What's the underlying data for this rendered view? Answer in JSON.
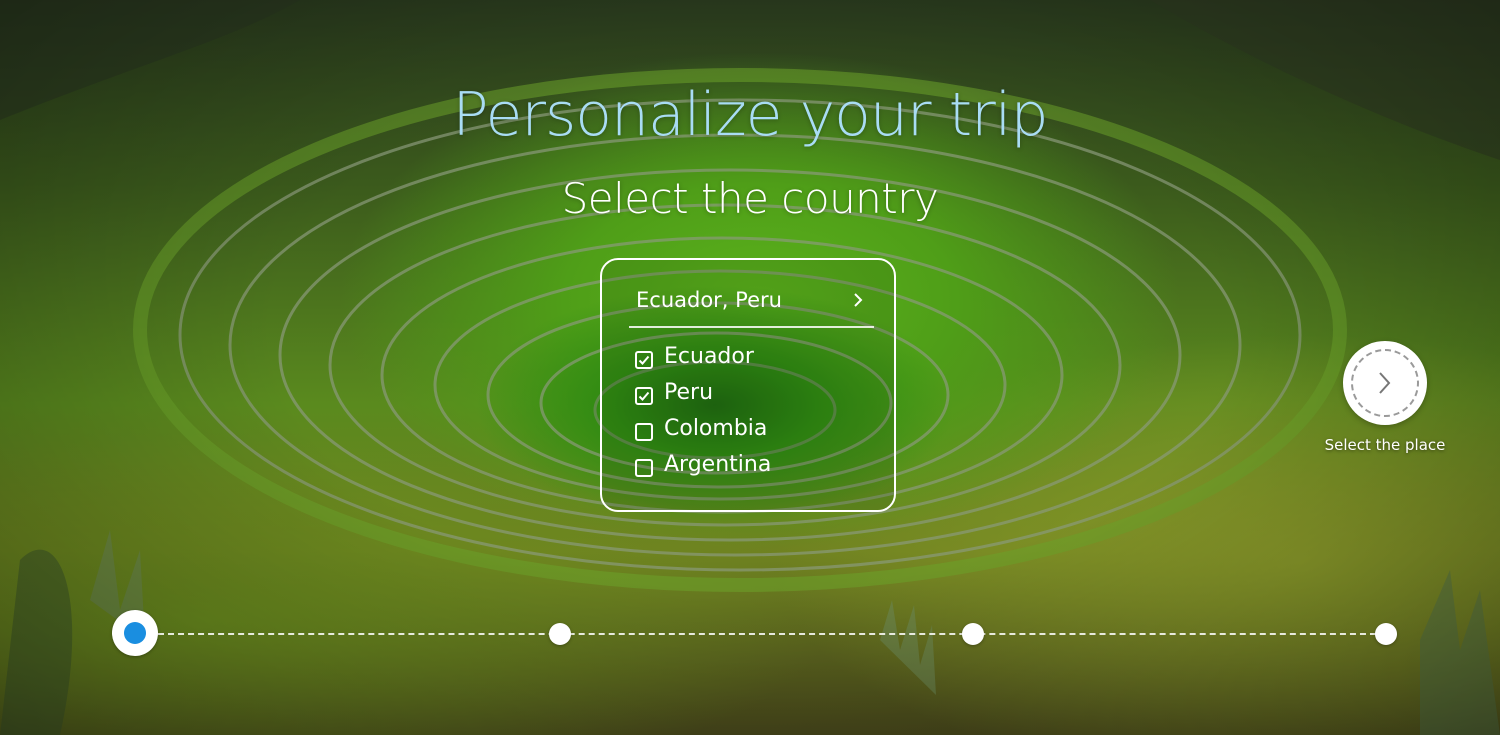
{
  "header": {
    "title": "Personalize your trip",
    "subtitle": "Select the country"
  },
  "country_select": {
    "selected_value": "Ecuador, Peru",
    "options": [
      {
        "label": "Ecuador",
        "checked": true
      },
      {
        "label": "Peru",
        "checked": true
      },
      {
        "label": "Colombia",
        "checked": false
      },
      {
        "label": "Argentina",
        "checked": false
      }
    ]
  },
  "next_step": {
    "label": "Select the place",
    "icon": "chevron-right-icon"
  },
  "progress": {
    "total_steps": 4,
    "current_step": 1
  },
  "colors": {
    "title": "#a9dcf4",
    "accent": "#1a8ee0"
  }
}
